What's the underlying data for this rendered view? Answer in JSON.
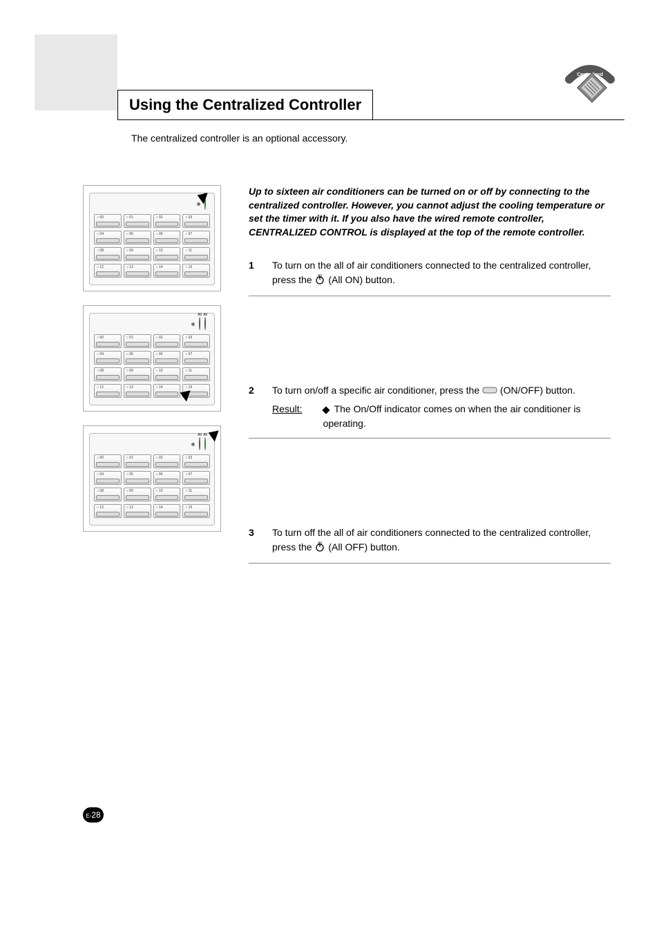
{
  "title": "Using the Centralized Controller",
  "sub_note": "The centralized controller is an optional accessory.",
  "intro": "Up to sixteen air conditioners can be turned on or off by connecting to the centralized controller. However, you cannot adjust the cooling temperature or set the timer with it. If you also have the wired remote controller, CENTRALIZED CONTROL is displayed at the top of the remote controller.",
  "steps": [
    {
      "num": "1",
      "text_before": "To turn on the all of air conditioners connected to the centralized controller, press the ",
      "icon": "all-on",
      "text_after": " (All ON) button.",
      "result": null
    },
    {
      "num": "2",
      "text_before": "To turn on/off a specific air conditioner, press the ",
      "icon": "onoff",
      "text_after": " (ON/OFF) button.",
      "result": {
        "label": "Result:",
        "text": "The On/Off indicator comes on when the air conditioner is operating."
      }
    },
    {
      "num": "3",
      "text_before": "To turn off the all of air conditioners connected to the centralized controller, press the ",
      "icon": "all-off",
      "text_after": " (All OFF) button.",
      "result": null
    }
  ],
  "logo_text": "Centralized Controller",
  "page_number_prefix": "E-",
  "page_number": "28",
  "device": {
    "top_icons": {
      "all_on": "All",
      "all_off": "All"
    },
    "cells": [
      [
        "00",
        "01",
        "02",
        "03"
      ],
      [
        "04",
        "05",
        "06",
        "07"
      ],
      [
        "08",
        "09",
        "10",
        "11"
      ],
      [
        "12",
        "13",
        "14",
        "15"
      ]
    ]
  }
}
